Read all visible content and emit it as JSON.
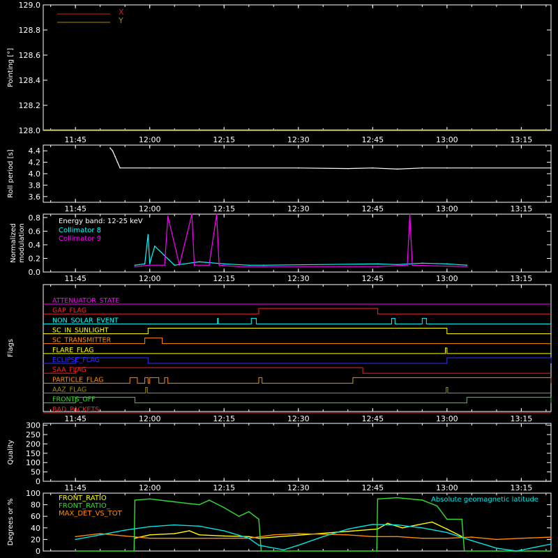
{
  "chart_data": [
    {
      "type": "line",
      "ylabel": "Pointing [°]",
      "ylim": [
        128.0,
        129.0
      ],
      "yticks": [
        "128.0",
        "128.2",
        "128.4",
        "128.6",
        "128.8",
        "129.0"
      ],
      "xticks": [
        "11:45",
        "12:00",
        "12:15",
        "12:30",
        "12:45",
        "13:00",
        "13:15"
      ],
      "legend": "top-left",
      "series": [
        {
          "name": "X",
          "color": "#cc2222",
          "x": [],
          "y": []
        },
        {
          "name": "Y",
          "color": "#a09000",
          "x": [],
          "y": []
        }
      ]
    },
    {
      "type": "line",
      "ylabel": "Roll period [s]",
      "ylim": [
        3.5,
        4.5
      ],
      "yticks": [
        "3.6",
        "3.8",
        "4.0",
        "4.2",
        "4.4"
      ],
      "xticks": [
        "11:45",
        "12:00",
        "12:15",
        "12:30",
        "12:45",
        "13:00",
        "13:15"
      ],
      "series": [
        {
          "name": "",
          "color": "#ffffff",
          "x": [
            "11:52",
            "11:52:30",
            "11:53",
            "11:53:30",
            "11:54",
            "12:00",
            "12:15",
            "12:30",
            "12:40",
            "12:45",
            "12:50",
            "12:55",
            "13:00",
            "13:05",
            "13:21"
          ],
          "y": [
            4.45,
            4.4,
            4.3,
            4.2,
            4.1,
            4.1,
            4.1,
            4.1,
            4.09,
            4.1,
            4.08,
            4.1,
            4.1,
            4.1,
            4.1
          ]
        }
      ]
    },
    {
      "type": "line",
      "ylabel": "Normalized modulation",
      "ylabel_lines": [
        "Normalized",
        "modulation"
      ],
      "ylim": [
        0.0,
        0.85
      ],
      "yticks": [
        "0.0",
        "0.2",
        "0.4",
        "0.6",
        "0.8"
      ],
      "xticks": [
        "11:45",
        "12:00",
        "12:15",
        "12:30",
        "12:45",
        "13:00",
        "13:15"
      ],
      "annotation": "Energy band: 12-25 keV",
      "legend": "top-left",
      "series": [
        {
          "name": "Collimator 8",
          "color": "#00ffff",
          "x": [
            "11:57",
            "11:59",
            "11:59:40",
            "12:00",
            "12:01",
            "12:05",
            "12:10",
            "12:15",
            "12:20",
            "12:23",
            "12:46",
            "12:50",
            "12:55",
            "13:00",
            "13:04"
          ],
          "y": [
            0.1,
            0.12,
            0.55,
            0.12,
            0.38,
            0.1,
            0.15,
            0.12,
            0.1,
            0.1,
            0.12,
            0.11,
            0.13,
            0.12,
            0.1
          ]
        },
        {
          "name": "Collimator 9",
          "color": "#ff00ff",
          "x": [
            "11:57",
            "12:00",
            "12:03",
            "12:03:40",
            "12:06",
            "12:08:30",
            "12:09",
            "12:12",
            "12:13:30",
            "12:14",
            "12:18",
            "12:23",
            "12:46",
            "12:52",
            "12:52:30",
            "12:53",
            "12:58",
            "13:04"
          ],
          "y": [
            0.08,
            0.1,
            0.1,
            0.82,
            0.1,
            0.85,
            0.1,
            0.1,
            0.85,
            0.1,
            0.08,
            0.08,
            0.08,
            0.1,
            0.85,
            0.1,
            0.09,
            0.08
          ]
        }
      ]
    },
    {
      "type": "line",
      "ylabel": "Flags",
      "xticks": [
        "11:45",
        "12:00",
        "12:15",
        "12:30",
        "12:45",
        "13:00",
        "13:15"
      ],
      "flags": [
        {
          "name": "ATTENUATOR_STATE",
          "color": "#ff00ff",
          "on": []
        },
        {
          "name": "GAP_FLAG",
          "color": "#ff2020",
          "on": [
            [
              "12:22",
              "12:46"
            ]
          ]
        },
        {
          "name": "NON_SOLAR_EVENT",
          "color": "#00ffff",
          "on": [
            [
              "12:13:40",
              "12:13:50"
            ],
            [
              "12:20:30",
              "12:21:30"
            ],
            [
              "12:48:50",
              "12:49:30"
            ],
            [
              "12:55",
              "12:55:50"
            ]
          ]
        },
        {
          "name": "SC_IN_SUNLIGHT",
          "color": "#ffff00",
          "on": [
            [
              "11:59:40",
              "13:00"
            ]
          ]
        },
        {
          "name": "SC_TRANSMITTER",
          "color": "#ff8c00",
          "on": [
            [
              "11:59",
              "12:02:30"
            ]
          ]
        },
        {
          "name": "FLARE_FLAG",
          "color": "#ffff00",
          "on": [
            [
              "12:59:40",
              "13:00"
            ]
          ]
        },
        {
          "name": "ECLIPSE_FLAG",
          "color": "#3030ff",
          "on": [
            [
              "11:45",
              "11:59:40"
            ],
            [
              "13:00",
              "13:21"
            ]
          ]
        },
        {
          "name": "SAA_FLAG",
          "color": "#ff2020",
          "on": [
            [
              "11:45",
              "12:43"
            ]
          ]
        },
        {
          "name": "PARTICLE_FLAG",
          "color": "#ff8c00",
          "on": [
            [
              "11:56",
              "11:57:30"
            ],
            [
              "11:59",
              "11:59:40"
            ],
            [
              "12:00",
              "12:01:50"
            ],
            [
              "12:03",
              "12:03:40"
            ],
            [
              "12:22",
              "12:22:40"
            ],
            [
              "12:41",
              "13:21"
            ]
          ]
        },
        {
          "name": "AAZ_FLAG",
          "color": "#a09000",
          "on": [
            [
              "11:59:10",
              "11:59:30"
            ],
            [
              "12:59:50",
              "13:00:10"
            ]
          ]
        },
        {
          "name": "FRONTS_OFF",
          "color": "#30e030",
          "on": [
            [
              "11:45",
              "11:57"
            ],
            [
              "13:04",
              "13:21"
            ]
          ]
        },
        {
          "name": "BAD_PACKETS",
          "color": "#ff2020",
          "on": []
        }
      ]
    },
    {
      "type": "line",
      "ylabel": "Quality",
      "ylim": [
        0,
        310
      ],
      "yticks": [
        "0",
        "50",
        "100",
        "150",
        "200",
        "250",
        "300"
      ],
      "xticks": [
        "11:45",
        "12:00",
        "12:15",
        "12:30",
        "12:45",
        "13:00",
        "13:15"
      ],
      "series": [
        {
          "name": "",
          "color": "#ffffff",
          "x": [
            "11:45",
            "13:21"
          ],
          "y": [
            0,
            0
          ]
        }
      ]
    },
    {
      "type": "line",
      "ylabel": "Degrees or %",
      "ylim": [
        0,
        100
      ],
      "yticks": [
        "0",
        "20",
        "40",
        "60",
        "80",
        "100"
      ],
      "legend": "top-left",
      "annotation": "Absolute geomagnetic latitude",
      "series": [
        {
          "name": "FRONT_RATIO",
          "color": "#ffff00",
          "x": [
            "11:57",
            "12:00",
            "12:05",
            "12:08",
            "12:10",
            "12:15",
            "12:20",
            "12:22",
            "12:46",
            "12:48",
            "12:51",
            "12:54",
            "12:57",
            "13:00",
            "13:03"
          ],
          "y": [
            22,
            28,
            30,
            35,
            28,
            26,
            25,
            22,
            38,
            48,
            40,
            45,
            50,
            38,
            25
          ]
        },
        {
          "name": "FRONT_RATIO_",
          "color": "#30e030",
          "x": [
            "11:45",
            "11:56:50",
            "11:57",
            "12:00",
            "12:05",
            "12:10",
            "12:12",
            "12:15",
            "12:18",
            "12:20",
            "12:22",
            "12:22:30",
            "12:45:50",
            "12:46",
            "12:50",
            "12:55",
            "12:58",
            "13:00",
            "13:03",
            "13:03:30",
            "13:21"
          ],
          "y": [
            0,
            0,
            88,
            90,
            85,
            80,
            88,
            75,
            60,
            68,
            55,
            0,
            0,
            90,
            92,
            88,
            78,
            55,
            55,
            0,
            0
          ]
        },
        {
          "name": "MAX_DET_VS_TOT",
          "color": "#ff8c00",
          "x": [
            "11:45",
            "11:50",
            "11:55",
            "12:00",
            "12:10",
            "12:20",
            "12:25",
            "12:30",
            "12:40",
            "12:45",
            "12:50",
            "12:55",
            "13:00",
            "13:05",
            "13:10",
            "13:15",
            "13:21"
          ],
          "y": [
            25,
            30,
            26,
            22,
            22,
            22,
            28,
            30,
            28,
            25,
            25,
            22,
            22,
            24,
            20,
            22,
            24
          ]
        },
        {
          "name": "",
          "color": "#00e5e5",
          "x": [
            "11:45",
            "11:50",
            "11:55",
            "12:00",
            "12:05",
            "12:10",
            "12:15",
            "12:20",
            "12:22",
            "12:27",
            "12:30",
            "12:35",
            "12:40",
            "12:45",
            "12:50",
            "12:55",
            "13:00",
            "13:05",
            "13:10",
            "13:14",
            "13:21"
          ],
          "y": [
            20,
            28,
            36,
            42,
            45,
            43,
            35,
            22,
            10,
            2,
            10,
            25,
            38,
            46,
            45,
            40,
            32,
            18,
            5,
            0,
            12
          ]
        }
      ]
    }
  ]
}
